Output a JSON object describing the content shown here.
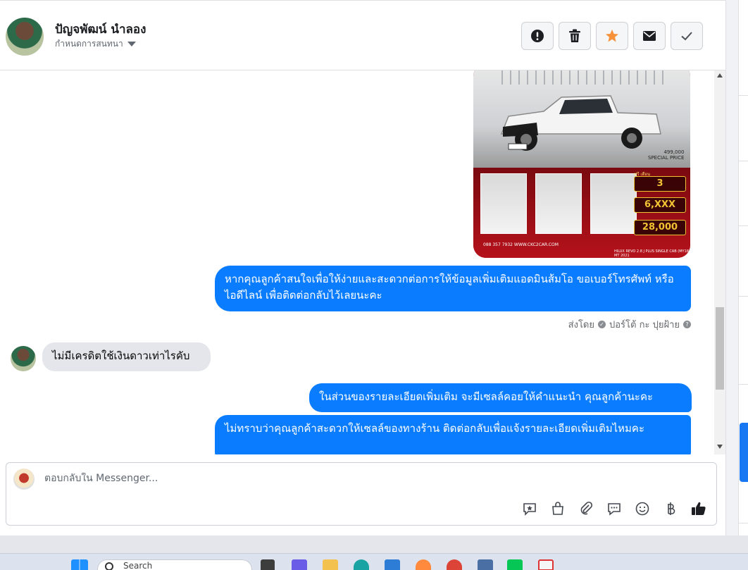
{
  "header": {
    "contact_name": "ปัญจพัฒน์ นำลอง",
    "conversation_settings_label": "กำหนดการสนทนา",
    "toolbar": [
      {
        "name": "report-spam-button",
        "icon": "exclamation-circle-icon"
      },
      {
        "name": "delete-button",
        "icon": "trash-icon"
      },
      {
        "name": "star-button",
        "icon": "star-icon"
      },
      {
        "name": "mark-unread-button",
        "icon": "envelope-icon"
      },
      {
        "name": "mark-done-button",
        "icon": "checkmark-icon"
      }
    ]
  },
  "chat": {
    "image_card": {
      "price": "499,000",
      "price_label": "SPECIAL PRICE",
      "badge_months": "3",
      "badge_months_prefix": "ฟรี",
      "badge_months_suffix": "เดือน",
      "badge_installment": "6,XXX",
      "badge_down": "28,000",
      "model_line": "HILUX REVO 2.8 J PLUS SINGLE CAB (MY18) MT 2021",
      "contact_line": "088 357 7932 WWW.CKC2CAR.COM"
    },
    "messages": [
      {
        "direction": "out",
        "text": "หากคุณลูกค้าสนใจเพื่อให้ง่ายและสะดวกต่อการให้ข้อมูลเพิ่มเติมแอดมินส้มโอ ขอเบอร์โทรศัพท์ หรือ ไอดีไลน์ เพื่อติดต่อกลับไว้เลยนะคะ"
      },
      {
        "direction": "in",
        "text": "ไม่มีเครดิตใช้เงินดาวเท่าไรคับ"
      },
      {
        "direction": "out",
        "text": "ในส่วนของรายละเอียดเพิ่มเติม จะมีเซลล์คอยให้คำแนะนำ คุณลูกค้านะคะ"
      },
      {
        "direction": "out",
        "text": "ไม่ทราบว่าคุณลูกค้าสะดวกให้เซลล์ของทางร้าน ติดต่อกลับเพื่อแจ้งรายละเอียดเพิ่มเติมไหมคะ"
      }
    ],
    "sent_by": {
      "prefix": "ส่งโดย",
      "sender": "ปอร์โต้ กะ ปุยฝ้าย",
      "help_glyph": "?"
    }
  },
  "composer": {
    "placeholder": "ตอบกลับใน Messenger...",
    "tools": [
      "saved-replies-icon",
      "shop-icon",
      "attachment-icon",
      "chat-bubble-icon",
      "emoji-icon",
      "baht-icon",
      "thumbs-up-icon"
    ]
  },
  "taskbar": {
    "search_label": "Search"
  },
  "colors": {
    "outgoing_bubble": "#0a7cff",
    "incoming_bubble": "#e4e6eb",
    "star_accent": "#f7923a"
  }
}
